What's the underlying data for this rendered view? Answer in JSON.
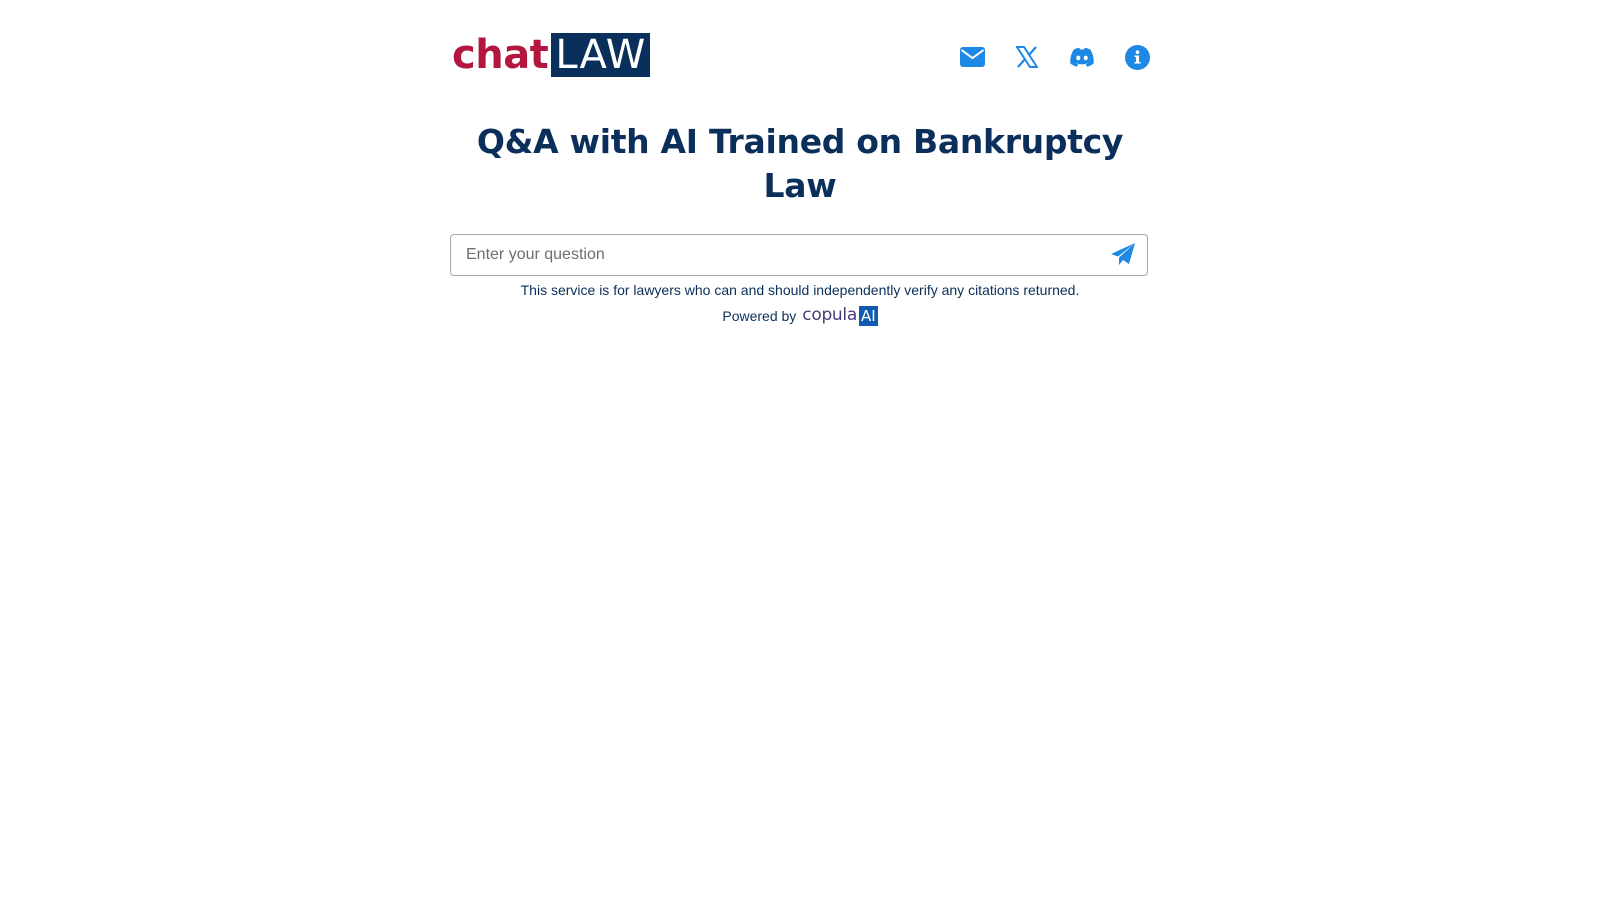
{
  "header": {
    "logo": {
      "part1": "chat",
      "part2": "LAW"
    },
    "icons": [
      {
        "name": "email-icon"
      },
      {
        "name": "x-twitter-icon"
      },
      {
        "name": "discord-icon"
      },
      {
        "name": "info-icon"
      }
    ]
  },
  "main": {
    "title": "Q&A with AI Trained on Bankruptcy Law",
    "search": {
      "placeholder": "Enter your question",
      "value": ""
    },
    "disclaimer": "This service is for lawyers who can and should independently verify any citations returned.",
    "powered_by": {
      "label": "Powered by",
      "brand_word": "copula",
      "brand_ai": "AI"
    }
  },
  "colors": {
    "brand_red": "#b3173f",
    "brand_navy": "#0b2f5b",
    "icon_blue": "#1e88e5",
    "copula_purple": "#4a3a7a",
    "copula_blue": "#0f5bb0"
  }
}
